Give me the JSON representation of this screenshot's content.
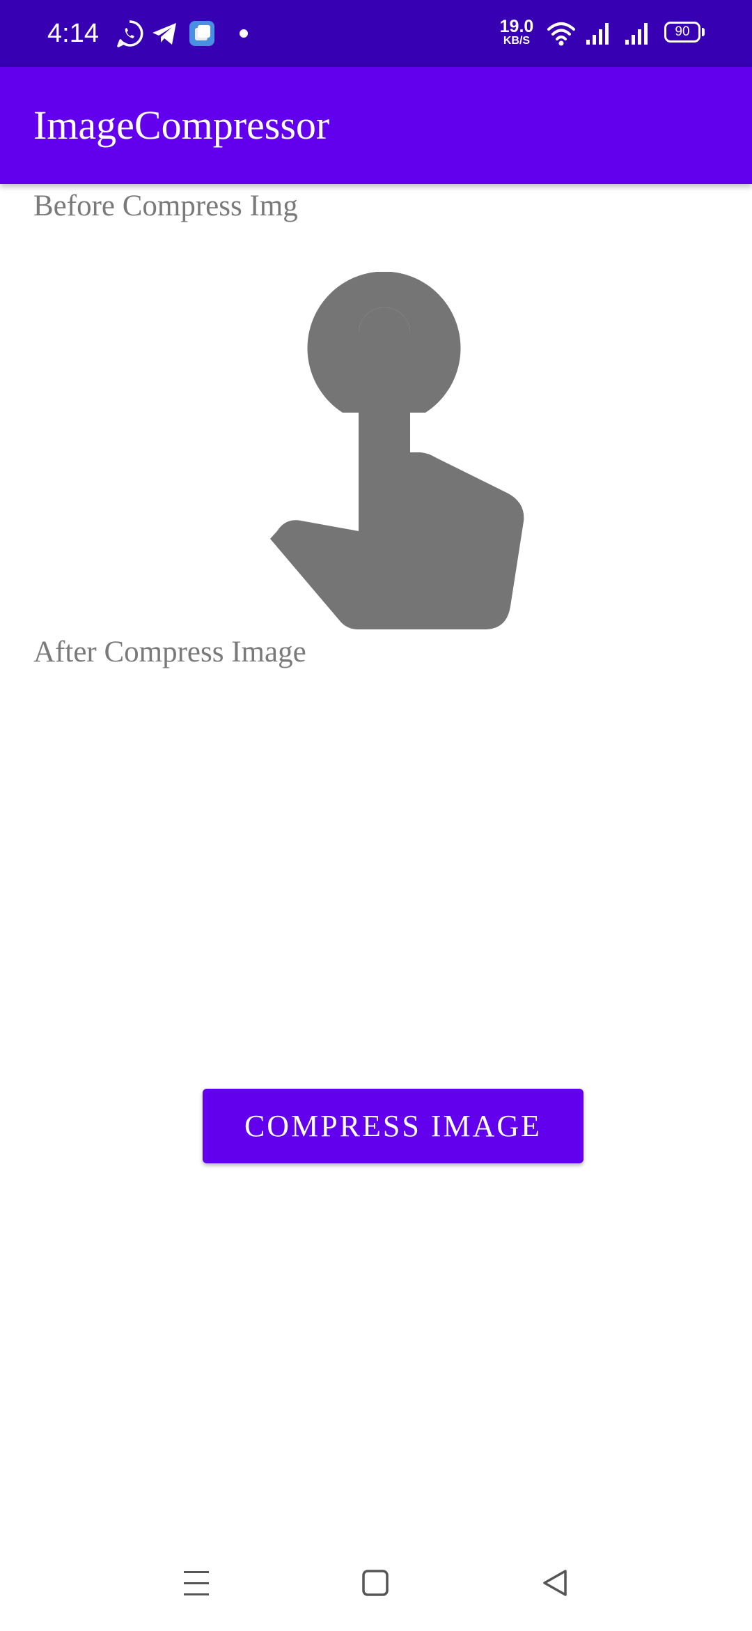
{
  "status_bar": {
    "time": "4:14",
    "speed_value": "19.0",
    "speed_unit": "KB/S",
    "battery": "90",
    "icons": [
      "whatsapp-icon",
      "telegram-icon",
      "app-notification-icon",
      "dot-icon",
      "wifi-icon",
      "signal-icon",
      "signal-icon-2",
      "battery-icon"
    ]
  },
  "app_bar": {
    "title": "ImageCompressor"
  },
  "main": {
    "before_label": "Before Compress Img",
    "after_label": "After Compress Image",
    "placeholder_icon": "touch-app-icon",
    "compress_button": "COMPRESS IMAGE"
  },
  "nav_bar": {
    "icons": [
      "menu-icon",
      "home-icon",
      "back-icon"
    ]
  },
  "colors": {
    "status_bar": "#3700b3",
    "primary": "#6200ee",
    "label_text": "#7a7a7a",
    "icon_gray": "#757575",
    "background": "#ffffff"
  }
}
